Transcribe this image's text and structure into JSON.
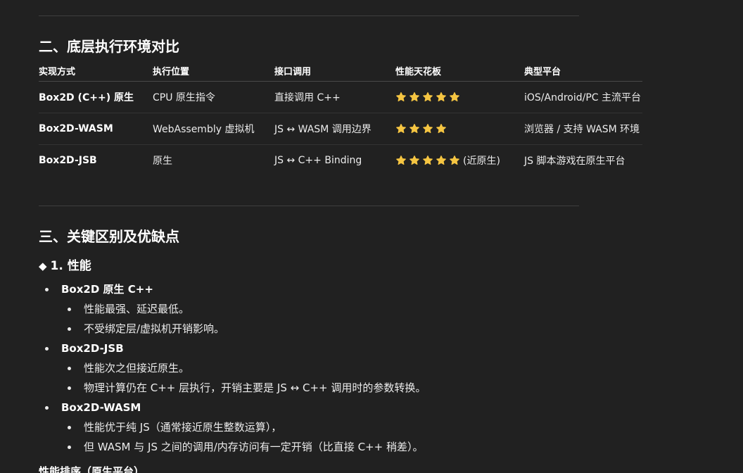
{
  "section2": {
    "title": "二、底层执行环境对比",
    "table": {
      "headers": [
        "实现方式",
        "执行位置",
        "接口调用",
        "性能天花板",
        "典型平台"
      ],
      "rows": [
        {
          "impl": "Box2D (C++) 原生",
          "location": "CPU 原生指令",
          "interface": "直接调用 C++",
          "stars": 5,
          "star_note": "",
          "platform": "iOS/Android/PC 主流平台"
        },
        {
          "impl": "Box2D-WASM",
          "location": "WebAssembly 虚拟机",
          "interface": "JS ↔ WASM 调用边界",
          "stars": 4,
          "star_note": "",
          "platform": "浏览器 / 支持 WASM 环境"
        },
        {
          "impl": "Box2D-JSB",
          "location": "原生",
          "interface": "JS ↔ C++ Binding",
          "stars": 5,
          "star_note": "(近原生)",
          "platform": "JS 脚本游戏在原生平台"
        }
      ]
    }
  },
  "section3": {
    "title": "三、关键区别及优缺点",
    "subtitle_marker": "◆",
    "subtitle": "1. 性能",
    "items": [
      {
        "label": "Box2D 原生 C++",
        "subs": [
          "性能最强、延迟最低。",
          "不受绑定层/虚拟机开销影响。"
        ]
      },
      {
        "label": "Box2D-JSB",
        "subs": [
          "性能次之但接近原生。",
          "物理计算仍在 C++ 层执行，开销主要是 JS ↔ C++ 调用时的参数转换。"
        ]
      },
      {
        "label": "Box2D-WASM",
        "subs": [
          "性能优于纯 JS（通常接近原生整数运算），",
          "但 WASM 与 JS 之间的调用/内存访问有一定开销（比直接 C++ 稍差）。"
        ]
      }
    ],
    "next_heading": "性能排序（原生平台）"
  },
  "colors": {
    "background": "#212121",
    "text": "#ececec",
    "star": "#f5c542",
    "divider": "#3f3f3f"
  },
  "icons": {
    "star": "star-icon",
    "diamond": "diamond-bullet-icon"
  }
}
